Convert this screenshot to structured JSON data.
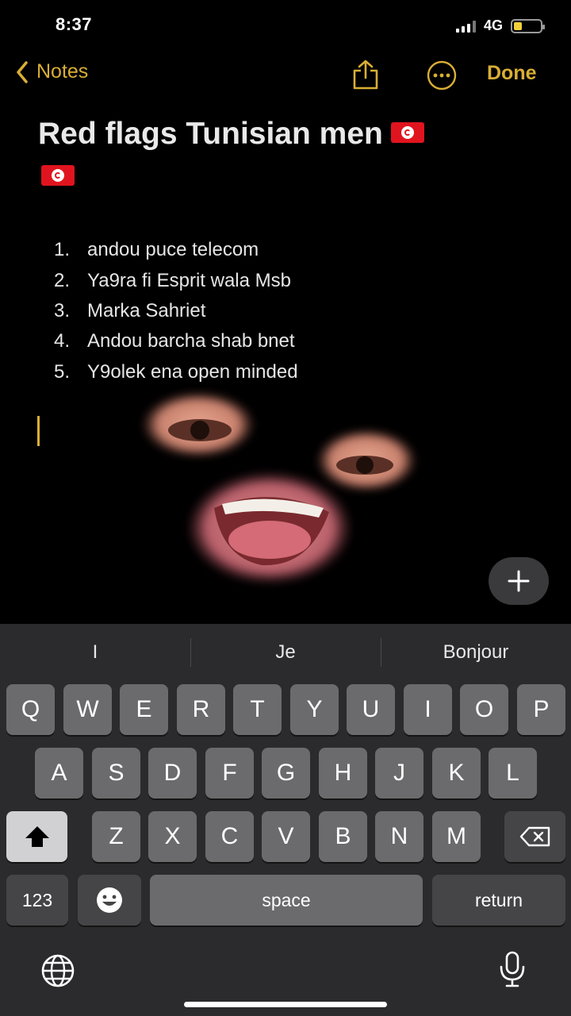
{
  "status": {
    "time": "8:37",
    "network": "4G",
    "battery_level": 0.3
  },
  "nav": {
    "back_label": "Notes",
    "done_label": "Done"
  },
  "note": {
    "title": "Red flags Tunisian men",
    "items": [
      {
        "num": "1.",
        "text": "andou puce telecom"
      },
      {
        "num": "2.",
        "text": "Ya9ra fi Esprit wala Msb"
      },
      {
        "num": "3.",
        "text": "Marka Sahriet"
      },
      {
        "num": "4.",
        "text": "Andou barcha shab bnet"
      },
      {
        "num": "5.",
        "text": "Y9olek ena open minded"
      }
    ]
  },
  "keyboard": {
    "suggestions": [
      "I",
      "Je",
      "Bonjour"
    ],
    "row1": [
      "Q",
      "W",
      "E",
      "R",
      "T",
      "Y",
      "U",
      "I",
      "O",
      "P"
    ],
    "row2": [
      "A",
      "S",
      "D",
      "F",
      "G",
      "H",
      "J",
      "K",
      "L"
    ],
    "row3": [
      "Z",
      "X",
      "C",
      "V",
      "B",
      "N",
      "M"
    ],
    "numbers_label": "123",
    "space_label": "space",
    "return_label": "return"
  },
  "colors": {
    "accent": "#d9ae34",
    "background": "#000000",
    "keyboard": "#2b2b2d"
  }
}
